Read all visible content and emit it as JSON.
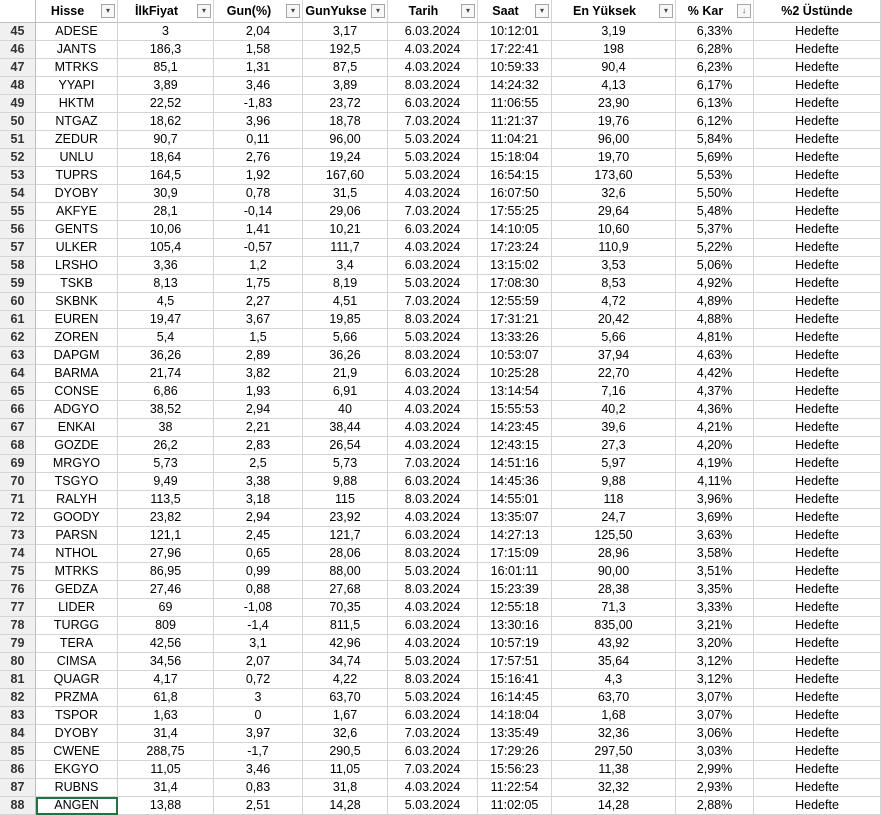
{
  "headers": [
    {
      "label": "Hisse",
      "filter": "▾"
    },
    {
      "label": "İlkFiyat",
      "filter": "▾"
    },
    {
      "label": "Gun(%)",
      "filter": "▾"
    },
    {
      "label": "GunYukse",
      "filter": "▾"
    },
    {
      "label": "Tarih",
      "filter": "▾"
    },
    {
      "label": "Saat",
      "filter": "▾"
    },
    {
      "label": "En Yüksek",
      "filter": "▾"
    },
    {
      "label": "% Kar",
      "filter": "↓"
    },
    {
      "label": "%2 Üstünde",
      "filter": ""
    }
  ],
  "rows": [
    [
      "45",
      "ADESE",
      "3",
      "2,04",
      "3,17",
      "6.03.2024",
      "10:12:01",
      "3,19",
      "6,33%",
      "Hedefte"
    ],
    [
      "46",
      "JANTS",
      "186,3",
      "1,58",
      "192,5",
      "4.03.2024",
      "17:22:41",
      "198",
      "6,28%",
      "Hedefte"
    ],
    [
      "47",
      "MTRKS",
      "85,1",
      "1,31",
      "87,5",
      "4.03.2024",
      "10:59:33",
      "90,4",
      "6,23%",
      "Hedefte"
    ],
    [
      "48",
      "YYAPI",
      "3,89",
      "3,46",
      "3,89",
      "8.03.2024",
      "14:24:32",
      "4,13",
      "6,17%",
      "Hedefte"
    ],
    [
      "49",
      "HKTM",
      "22,52",
      "-1,83",
      "23,72",
      "6.03.2024",
      "11:06:55",
      "23,90",
      "6,13%",
      "Hedefte"
    ],
    [
      "50",
      "NTGAZ",
      "18,62",
      "3,96",
      "18,78",
      "7.03.2024",
      "11:21:37",
      "19,76",
      "6,12%",
      "Hedefte"
    ],
    [
      "51",
      "ZEDUR",
      "90,7",
      "0,11",
      "96,00",
      "5.03.2024",
      "11:04:21",
      "96,00",
      "5,84%",
      "Hedefte"
    ],
    [
      "52",
      "UNLU",
      "18,64",
      "2,76",
      "19,24",
      "5.03.2024",
      "15:18:04",
      "19,70",
      "5,69%",
      "Hedefte"
    ],
    [
      "53",
      "TUPRS",
      "164,5",
      "1,92",
      "167,60",
      "5.03.2024",
      "16:54:15",
      "173,60",
      "5,53%",
      "Hedefte"
    ],
    [
      "54",
      "DYOBY",
      "30,9",
      "0,78",
      "31,5",
      "4.03.2024",
      "16:07:50",
      "32,6",
      "5,50%",
      "Hedefte"
    ],
    [
      "55",
      "AKFYE",
      "28,1",
      "-0,14",
      "29,06",
      "7.03.2024",
      "17:55:25",
      "29,64",
      "5,48%",
      "Hedefte"
    ],
    [
      "56",
      "GENTS",
      "10,06",
      "1,41",
      "10,21",
      "6.03.2024",
      "14:10:05",
      "10,60",
      "5,37%",
      "Hedefte"
    ],
    [
      "57",
      "ULKER",
      "105,4",
      "-0,57",
      "111,7",
      "4.03.2024",
      "17:23:24",
      "110,9",
      "5,22%",
      "Hedefte"
    ],
    [
      "58",
      "LRSHO",
      "3,36",
      "1,2",
      "3,4",
      "6.03.2024",
      "13:15:02",
      "3,53",
      "5,06%",
      "Hedefte"
    ],
    [
      "59",
      "TSKB",
      "8,13",
      "1,75",
      "8,19",
      "5.03.2024",
      "17:08:30",
      "8,53",
      "4,92%",
      "Hedefte"
    ],
    [
      "60",
      "SKBNK",
      "4,5",
      "2,27",
      "4,51",
      "7.03.2024",
      "12:55:59",
      "4,72",
      "4,89%",
      "Hedefte"
    ],
    [
      "61",
      "EUREN",
      "19,47",
      "3,67",
      "19,85",
      "8.03.2024",
      "17:31:21",
      "20,42",
      "4,88%",
      "Hedefte"
    ],
    [
      "62",
      "ZOREN",
      "5,4",
      "1,5",
      "5,66",
      "5.03.2024",
      "13:33:26",
      "5,66",
      "4,81%",
      "Hedefte"
    ],
    [
      "63",
      "DAPGM",
      "36,26",
      "2,89",
      "36,26",
      "8.03.2024",
      "10:53:07",
      "37,94",
      "4,63%",
      "Hedefte"
    ],
    [
      "64",
      "BARMA",
      "21,74",
      "3,82",
      "21,9",
      "6.03.2024",
      "10:25:28",
      "22,70",
      "4,42%",
      "Hedefte"
    ],
    [
      "65",
      "CONSE",
      "6,86",
      "1,93",
      "6,91",
      "4.03.2024",
      "13:14:54",
      "7,16",
      "4,37%",
      "Hedefte"
    ],
    [
      "66",
      "ADGYO",
      "38,52",
      "2,94",
      "40",
      "4.03.2024",
      "15:55:53",
      "40,2",
      "4,36%",
      "Hedefte"
    ],
    [
      "67",
      "ENKAI",
      "38",
      "2,21",
      "38,44",
      "4.03.2024",
      "14:23:45",
      "39,6",
      "4,21%",
      "Hedefte"
    ],
    [
      "68",
      "GOZDE",
      "26,2",
      "2,83",
      "26,54",
      "4.03.2024",
      "12:43:15",
      "27,3",
      "4,20%",
      "Hedefte"
    ],
    [
      "69",
      "MRGYO",
      "5,73",
      "2,5",
      "5,73",
      "7.03.2024",
      "14:51:16",
      "5,97",
      "4,19%",
      "Hedefte"
    ],
    [
      "70",
      "TSGYO",
      "9,49",
      "3,38",
      "9,88",
      "6.03.2024",
      "14:45:36",
      "9,88",
      "4,11%",
      "Hedefte"
    ],
    [
      "71",
      "RALYH",
      "113,5",
      "3,18",
      "115",
      "8.03.2024",
      "14:55:01",
      "118",
      "3,96%",
      "Hedefte"
    ],
    [
      "72",
      "GOODY",
      "23,82",
      "2,94",
      "23,92",
      "4.03.2024",
      "13:35:07",
      "24,7",
      "3,69%",
      "Hedefte"
    ],
    [
      "73",
      "PARSN",
      "121,1",
      "2,45",
      "121,7",
      "6.03.2024",
      "14:27:13",
      "125,50",
      "3,63%",
      "Hedefte"
    ],
    [
      "74",
      "NTHOL",
      "27,96",
      "0,65",
      "28,06",
      "8.03.2024",
      "17:15:09",
      "28,96",
      "3,58%",
      "Hedefte"
    ],
    [
      "75",
      "MTRKS",
      "86,95",
      "0,99",
      "88,00",
      "5.03.2024",
      "16:01:11",
      "90,00",
      "3,51%",
      "Hedefte"
    ],
    [
      "76",
      "GEDZA",
      "27,46",
      "0,88",
      "27,68",
      "8.03.2024",
      "15:23:39",
      "28,38",
      "3,35%",
      "Hedefte"
    ],
    [
      "77",
      "LIDER",
      "69",
      "-1,08",
      "70,35",
      "4.03.2024",
      "12:55:18",
      "71,3",
      "3,33%",
      "Hedefte"
    ],
    [
      "78",
      "TURGG",
      "809",
      "-1,4",
      "811,5",
      "6.03.2024",
      "13:30:16",
      "835,00",
      "3,21%",
      "Hedefte"
    ],
    [
      "79",
      "TERA",
      "42,56",
      "3,1",
      "42,96",
      "4.03.2024",
      "10:57:19",
      "43,92",
      "3,20%",
      "Hedefte"
    ],
    [
      "80",
      "CIMSA",
      "34,56",
      "2,07",
      "34,74",
      "5.03.2024",
      "17:57:51",
      "35,64",
      "3,12%",
      "Hedefte"
    ],
    [
      "81",
      "QUAGR",
      "4,17",
      "0,72",
      "4,22",
      "8.03.2024",
      "15:16:41",
      "4,3",
      "3,12%",
      "Hedefte"
    ],
    [
      "82",
      "PRZMA",
      "61,8",
      "3",
      "63,70",
      "5.03.2024",
      "16:14:45",
      "63,70",
      "3,07%",
      "Hedefte"
    ],
    [
      "83",
      "TSPOR",
      "1,63",
      "0",
      "1,67",
      "6.03.2024",
      "14:18:04",
      "1,68",
      "3,07%",
      "Hedefte"
    ],
    [
      "84",
      "DYOBY",
      "31,4",
      "3,97",
      "32,6",
      "7.03.2024",
      "13:35:49",
      "32,36",
      "3,06%",
      "Hedefte"
    ],
    [
      "85",
      "CWENE",
      "288,75",
      "-1,7",
      "290,5",
      "6.03.2024",
      "17:29:26",
      "297,50",
      "3,03%",
      "Hedefte"
    ],
    [
      "86",
      "EKGYO",
      "11,05",
      "3,46",
      "11,05",
      "7.03.2024",
      "15:56:23",
      "11,38",
      "2,99%",
      "Hedefte"
    ],
    [
      "87",
      "RUBNS",
      "31,4",
      "0,83",
      "31,8",
      "4.03.2024",
      "11:22:54",
      "32,32",
      "2,93%",
      "Hedefte"
    ],
    [
      "88",
      "ANGEN",
      "13,88",
      "2,51",
      "14,28",
      "5.03.2024",
      "11:02:05",
      "14,28",
      "2,88%",
      "Hedefte"
    ]
  ],
  "active_cell": {
    "row_label": "88",
    "column_label": "Hisse"
  },
  "colors": {
    "grid": "#d4d4d4",
    "header_bg": "#f0f0f0",
    "selection": "#217346"
  }
}
